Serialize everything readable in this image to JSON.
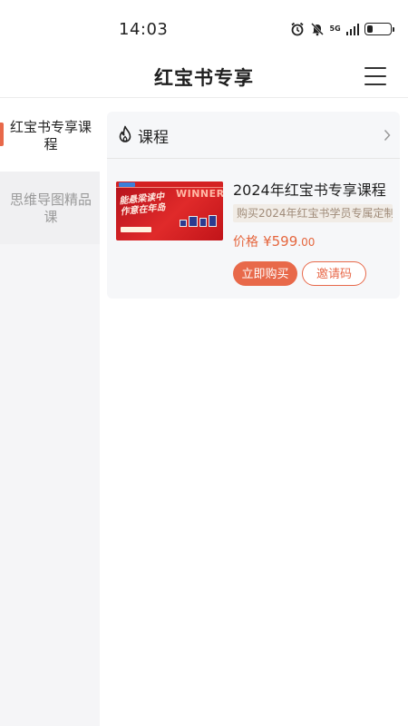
{
  "status_bar": {
    "time": "14:03",
    "network": "5G",
    "icons": [
      "alarm-icon",
      "mute-icon",
      "5g-icon",
      "signal-icon",
      "battery-icon"
    ],
    "battery_level": 0.25
  },
  "header": {
    "title": "红宝书专享",
    "menu_icon": "menu-icon"
  },
  "sidebar": {
    "items": [
      {
        "label": "红宝书专享课程",
        "active": true
      },
      {
        "label": "思维导图精品课",
        "active": false
      }
    ]
  },
  "section": {
    "title": "课程",
    "icon": "fire-icon",
    "more_icon": "chevron-right-icon"
  },
  "course": {
    "name": "2024年红宝书专享课程",
    "description": "购买2024年红宝书学员专属定制",
    "price_label": "价格",
    "price_currency": "¥",
    "price_integer": "599",
    "price_decimal": ".00",
    "thumbnail": {
      "script_line1": "能悬梁读中",
      "script_line2": "作意在年岛",
      "winner": "WINNER"
    },
    "buy_label": "立即购买",
    "invite_label": "邀请码"
  },
  "colors": {
    "accent": "#e8694a",
    "price": "#e5673f",
    "sidebar_bg": "#f5f5f7",
    "card_bg": "#f6f7f9"
  }
}
